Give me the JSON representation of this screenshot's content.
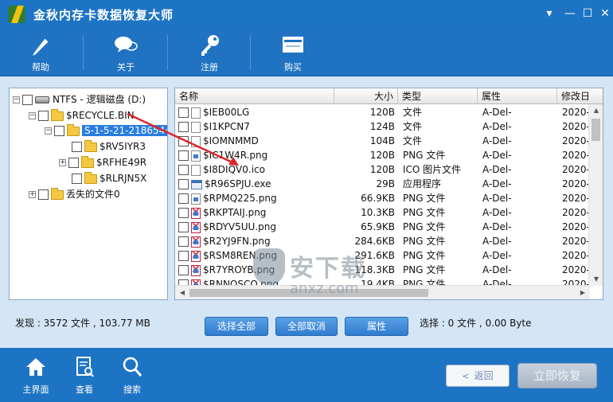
{
  "app": {
    "title": "金秋内存卡数据恢复大师"
  },
  "window_controls": {
    "menu": "▾",
    "minimize": "—",
    "maximize": "☐",
    "close": "✕"
  },
  "toolbar": {
    "items": [
      {
        "label": "帮助",
        "icon": "pen-icon"
      },
      {
        "label": "关于",
        "icon": "chat-bubbles-icon"
      },
      {
        "label": "注册",
        "icon": "key-icon"
      },
      {
        "label": "购买",
        "icon": "register-card-icon"
      }
    ]
  },
  "tree": {
    "root": "NTFS - 逻辑磁盘 (D:)",
    "recycle": "$RECYCLE.BIN",
    "sid": "S-1-5-21-2186544",
    "children": [
      "$RV5IYR3",
      "$RFHE49R",
      "$RLRJN5X"
    ],
    "lost": "丢失的文件0",
    "expander_plus": "+",
    "expander_minus": "−"
  },
  "list": {
    "columns": [
      "名称",
      "大小",
      "类型",
      "属性",
      "修改日"
    ],
    "rows": [
      {
        "name": "$IEB00LG",
        "size": "120B",
        "type": "文件",
        "attr": "A-Del-",
        "date": "2020-",
        "icon": "file",
        "bad": false
      },
      {
        "name": "$I1KPCN7",
        "size": "124B",
        "type": "文件",
        "attr": "A-Del-",
        "date": "2020-",
        "icon": "file",
        "bad": false
      },
      {
        "name": "$IOMNMMD",
        "size": "104B",
        "type": "文件",
        "attr": "A-Del-",
        "date": "2020-",
        "icon": "file",
        "bad": false
      },
      {
        "name": "$IC1W4R.png",
        "size": "120B",
        "type": "PNG 文件",
        "attr": "A-Del-",
        "date": "2020-",
        "icon": "img",
        "bad": false
      },
      {
        "name": "$I8DIQV0.ico",
        "size": "120B",
        "type": "ICO 图片文件",
        "attr": "A-Del-",
        "date": "2020-",
        "icon": "file",
        "bad": false
      },
      {
        "name": "$R96SPJU.exe",
        "size": "29B",
        "type": "应用程序",
        "attr": "A-Del-",
        "date": "2020-",
        "icon": "exe",
        "bad": false
      },
      {
        "name": "$RPMQ225.png",
        "size": "66.9KB",
        "type": "PNG 文件",
        "attr": "A-Del-",
        "date": "2020-",
        "icon": "img",
        "bad": false
      },
      {
        "name": "$RKPTAIJ.png",
        "size": "10.3KB",
        "type": "PNG 文件",
        "attr": "A-Del-",
        "date": "2020-",
        "icon": "img",
        "bad": true
      },
      {
        "name": "$RDYV5UU.png",
        "size": "65.9KB",
        "type": "PNG 文件",
        "attr": "A-Del-",
        "date": "2020-",
        "icon": "img",
        "bad": true
      },
      {
        "name": "$R2YJ9FN.png",
        "size": "284.6KB",
        "type": "PNG 文件",
        "attr": "A-Del-",
        "date": "2020-",
        "icon": "img",
        "bad": true
      },
      {
        "name": "$RSM8REN.png",
        "size": "291.6KB",
        "type": "PNG 文件",
        "attr": "A-Del-",
        "date": "2020-",
        "icon": "img",
        "bad": true
      },
      {
        "name": "$R7YROYB.png",
        "size": "118.3KB",
        "type": "PNG 文件",
        "attr": "A-Del-",
        "date": "2020-",
        "icon": "img",
        "bad": true
      },
      {
        "name": "$RNNOSCO.png",
        "size": "19.4KB",
        "type": "PNG 文件",
        "attr": "A-Del-",
        "date": "2020-",
        "icon": "img",
        "bad": true
      }
    ],
    "scroll_up": "▲",
    "scroll_down": "▼",
    "scroll_left": "◀",
    "scroll_right": "▶"
  },
  "status": {
    "found": "发现 : 3572 文件 , 103.77 MB",
    "selected": "选择 : 0 文件 , 0.00 Byte"
  },
  "actions": {
    "select_all": "选择全部",
    "deselect_all": "全部取消",
    "properties": "属性"
  },
  "footer": {
    "items": [
      {
        "label": "主界面",
        "icon": "home-icon"
      },
      {
        "label": "查看",
        "icon": "document-view-icon"
      },
      {
        "label": "搜索",
        "icon": "search-icon"
      }
    ],
    "back": "返回",
    "recover": "立即恢复"
  },
  "watermark": {
    "text": "安下载",
    "url": "anxz.com"
  },
  "colors": {
    "title_bar": "#1e74c4",
    "accent_button": "#2f7cd0",
    "selection": "#2a7de1",
    "arrow": "#d9262a"
  }
}
